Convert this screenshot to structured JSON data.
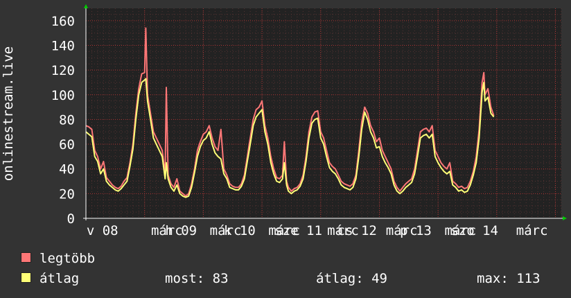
{
  "chart_data": {
    "type": "line",
    "ylabel": "onlinestream.live",
    "ylim": [
      0,
      170
    ],
    "yticks": [
      0,
      20,
      40,
      60,
      80,
      100,
      120,
      140,
      160
    ],
    "xlim": [
      0,
      8.1
    ],
    "xticks": [
      {
        "x": 0.28,
        "label": "v 08"
      },
      {
        "x": 1.38,
        "label": "márc"
      },
      {
        "x": 1.62,
        "label": "h 09"
      },
      {
        "x": 2.38,
        "label": "márc"
      },
      {
        "x": 2.62,
        "label": "k 10"
      },
      {
        "x": 3.38,
        "label": "márc"
      },
      {
        "x": 3.62,
        "label": "sze 11"
      },
      {
        "x": 4.38,
        "label": "márc"
      },
      {
        "x": 4.62,
        "label": "cs 12"
      },
      {
        "x": 5.38,
        "label": "márc"
      },
      {
        "x": 5.62,
        "label": "p 13"
      },
      {
        "x": 6.38,
        "label": "márc"
      },
      {
        "x": 6.62,
        "label": "szo 14"
      },
      {
        "x": 7.6,
        "label": "márc"
      }
    ],
    "grid": true,
    "colors": {
      "max": "#ff7777",
      "avg": "#ffff77",
      "grid": "#aa3333",
      "axis": "#ffffff",
      "background": "#222222"
    },
    "series": [
      {
        "name": "legtöbb",
        "color": "#ff7777",
        "points": [
          [
            0.0,
            75
          ],
          [
            0.05,
            74
          ],
          [
            0.1,
            72
          ],
          [
            0.15,
            55
          ],
          [
            0.2,
            50
          ],
          [
            0.25,
            40
          ],
          [
            0.3,
            46
          ],
          [
            0.35,
            33
          ],
          [
            0.4,
            30
          ],
          [
            0.45,
            27
          ],
          [
            0.5,
            25
          ],
          [
            0.55,
            24
          ],
          [
            0.6,
            26
          ],
          [
            0.65,
            30
          ],
          [
            0.7,
            33
          ],
          [
            0.75,
            45
          ],
          [
            0.8,
            60
          ],
          [
            0.85,
            85
          ],
          [
            0.9,
            105
          ],
          [
            0.95,
            117
          ],
          [
            1.0,
            118
          ],
          [
            1.02,
            154
          ],
          [
            1.05,
            100
          ],
          [
            1.1,
            85
          ],
          [
            1.15,
            70
          ],
          [
            1.2,
            65
          ],
          [
            1.25,
            60
          ],
          [
            1.3,
            55
          ],
          [
            1.35,
            35
          ],
          [
            1.37,
            106
          ],
          [
            1.4,
            35
          ],
          [
            1.45,
            28
          ],
          [
            1.5,
            25
          ],
          [
            1.55,
            32
          ],
          [
            1.6,
            22
          ],
          [
            1.65,
            20
          ],
          [
            1.7,
            18
          ],
          [
            1.75,
            20
          ],
          [
            1.8,
            28
          ],
          [
            1.85,
            40
          ],
          [
            1.9,
            55
          ],
          [
            1.95,
            62
          ],
          [
            2.0,
            68
          ],
          [
            2.05,
            70
          ],
          [
            2.1,
            75
          ],
          [
            2.15,
            65
          ],
          [
            2.2,
            58
          ],
          [
            2.25,
            55
          ],
          [
            2.3,
            72
          ],
          [
            2.35,
            40
          ],
          [
            2.4,
            35
          ],
          [
            2.45,
            28
          ],
          [
            2.5,
            26
          ],
          [
            2.55,
            25
          ],
          [
            2.6,
            25
          ],
          [
            2.65,
            28
          ],
          [
            2.7,
            35
          ],
          [
            2.75,
            50
          ],
          [
            2.8,
            65
          ],
          [
            2.85,
            80
          ],
          [
            2.9,
            88
          ],
          [
            2.95,
            90
          ],
          [
            3.0,
            95
          ],
          [
            3.05,
            75
          ],
          [
            3.1,
            65
          ],
          [
            3.15,
            50
          ],
          [
            3.2,
            40
          ],
          [
            3.25,
            33
          ],
          [
            3.3,
            32
          ],
          [
            3.35,
            35
          ],
          [
            3.38,
            62
          ],
          [
            3.42,
            30
          ],
          [
            3.45,
            25
          ],
          [
            3.5,
            22
          ],
          [
            3.55,
            24
          ],
          [
            3.6,
            25
          ],
          [
            3.65,
            28
          ],
          [
            3.7,
            35
          ],
          [
            3.75,
            50
          ],
          [
            3.8,
            70
          ],
          [
            3.85,
            82
          ],
          [
            3.9,
            86
          ],
          [
            3.95,
            87
          ],
          [
            4.0,
            70
          ],
          [
            4.05,
            65
          ],
          [
            4.1,
            55
          ],
          [
            4.15,
            45
          ],
          [
            4.2,
            42
          ],
          [
            4.25,
            40
          ],
          [
            4.3,
            35
          ],
          [
            4.35,
            30
          ],
          [
            4.4,
            28
          ],
          [
            4.45,
            27
          ],
          [
            4.5,
            26
          ],
          [
            4.55,
            28
          ],
          [
            4.6,
            35
          ],
          [
            4.65,
            55
          ],
          [
            4.7,
            78
          ],
          [
            4.75,
            90
          ],
          [
            4.8,
            85
          ],
          [
            4.85,
            75
          ],
          [
            4.9,
            70
          ],
          [
            4.95,
            62
          ],
          [
            5.0,
            65
          ],
          [
            5.05,
            55
          ],
          [
            5.1,
            50
          ],
          [
            5.15,
            45
          ],
          [
            5.2,
            40
          ],
          [
            5.25,
            30
          ],
          [
            5.3,
            25
          ],
          [
            5.35,
            22
          ],
          [
            5.4,
            25
          ],
          [
            5.45,
            28
          ],
          [
            5.5,
            30
          ],
          [
            5.55,
            32
          ],
          [
            5.6,
            40
          ],
          [
            5.65,
            55
          ],
          [
            5.7,
            70
          ],
          [
            5.75,
            72
          ],
          [
            5.8,
            73
          ],
          [
            5.85,
            70
          ],
          [
            5.9,
            75
          ],
          [
            5.95,
            55
          ],
          [
            6.0,
            50
          ],
          [
            6.05,
            45
          ],
          [
            6.1,
            42
          ],
          [
            6.15,
            40
          ],
          [
            6.2,
            45
          ],
          [
            6.25,
            30
          ],
          [
            6.3,
            28
          ],
          [
            6.35,
            25
          ],
          [
            6.4,
            26
          ],
          [
            6.45,
            24
          ],
          [
            6.5,
            25
          ],
          [
            6.55,
            30
          ],
          [
            6.6,
            38
          ],
          [
            6.65,
            50
          ],
          [
            6.7,
            72
          ],
          [
            6.75,
            110
          ],
          [
            6.78,
            118
          ],
          [
            6.8,
            100
          ],
          [
            6.85,
            105
          ],
          [
            6.9,
            90
          ],
          [
            6.95,
            83
          ]
        ]
      },
      {
        "name": "átlag",
        "color": "#ffff77",
        "points": [
          [
            0.0,
            70
          ],
          [
            0.05,
            68
          ],
          [
            0.1,
            66
          ],
          [
            0.15,
            50
          ],
          [
            0.2,
            46
          ],
          [
            0.25,
            36
          ],
          [
            0.3,
            40
          ],
          [
            0.35,
            30
          ],
          [
            0.4,
            27
          ],
          [
            0.45,
            25
          ],
          [
            0.5,
            23
          ],
          [
            0.55,
            22
          ],
          [
            0.6,
            24
          ],
          [
            0.65,
            27
          ],
          [
            0.7,
            30
          ],
          [
            0.75,
            42
          ],
          [
            0.8,
            56
          ],
          [
            0.85,
            80
          ],
          [
            0.9,
            100
          ],
          [
            0.95,
            110
          ],
          [
            1.0,
            112
          ],
          [
            1.02,
            113
          ],
          [
            1.05,
            95
          ],
          [
            1.1,
            80
          ],
          [
            1.15,
            65
          ],
          [
            1.2,
            60
          ],
          [
            1.25,
            55
          ],
          [
            1.3,
            50
          ],
          [
            1.35,
            32
          ],
          [
            1.37,
            45
          ],
          [
            1.4,
            32
          ],
          [
            1.45,
            25
          ],
          [
            1.5,
            22
          ],
          [
            1.55,
            27
          ],
          [
            1.6,
            20
          ],
          [
            1.65,
            18
          ],
          [
            1.7,
            17
          ],
          [
            1.75,
            18
          ],
          [
            1.8,
            25
          ],
          [
            1.85,
            37
          ],
          [
            1.9,
            50
          ],
          [
            1.95,
            58
          ],
          [
            2.0,
            63
          ],
          [
            2.05,
            65
          ],
          [
            2.1,
            70
          ],
          [
            2.15,
            60
          ],
          [
            2.2,
            53
          ],
          [
            2.25,
            50
          ],
          [
            2.3,
            48
          ],
          [
            2.35,
            36
          ],
          [
            2.4,
            32
          ],
          [
            2.45,
            25
          ],
          [
            2.5,
            24
          ],
          [
            2.55,
            23
          ],
          [
            2.6,
            23
          ],
          [
            2.65,
            26
          ],
          [
            2.7,
            32
          ],
          [
            2.75,
            46
          ],
          [
            2.8,
            60
          ],
          [
            2.85,
            75
          ],
          [
            2.9,
            82
          ],
          [
            2.95,
            85
          ],
          [
            3.0,
            88
          ],
          [
            3.05,
            70
          ],
          [
            3.1,
            60
          ],
          [
            3.15,
            45
          ],
          [
            3.2,
            36
          ],
          [
            3.25,
            30
          ],
          [
            3.3,
            29
          ],
          [
            3.35,
            32
          ],
          [
            3.38,
            45
          ],
          [
            3.42,
            27
          ],
          [
            3.45,
            22
          ],
          [
            3.5,
            20
          ],
          [
            3.55,
            22
          ],
          [
            3.6,
            23
          ],
          [
            3.65,
            26
          ],
          [
            3.7,
            32
          ],
          [
            3.75,
            46
          ],
          [
            3.8,
            65
          ],
          [
            3.85,
            77
          ],
          [
            3.9,
            80
          ],
          [
            3.95,
            81
          ],
          [
            4.0,
            65
          ],
          [
            4.05,
            60
          ],
          [
            4.1,
            50
          ],
          [
            4.15,
            41
          ],
          [
            4.2,
            38
          ],
          [
            4.25,
            36
          ],
          [
            4.3,
            32
          ],
          [
            4.35,
            27
          ],
          [
            4.4,
            25
          ],
          [
            4.45,
            24
          ],
          [
            4.5,
            23
          ],
          [
            4.55,
            25
          ],
          [
            4.6,
            32
          ],
          [
            4.65,
            50
          ],
          [
            4.7,
            72
          ],
          [
            4.75,
            86
          ],
          [
            4.8,
            80
          ],
          [
            4.85,
            70
          ],
          [
            4.9,
            65
          ],
          [
            4.95,
            57
          ],
          [
            5.0,
            58
          ],
          [
            5.05,
            50
          ],
          [
            5.1,
            45
          ],
          [
            5.15,
            41
          ],
          [
            5.2,
            36
          ],
          [
            5.25,
            27
          ],
          [
            5.3,
            22
          ],
          [
            5.35,
            20
          ],
          [
            5.4,
            22
          ],
          [
            5.45,
            25
          ],
          [
            5.5,
            27
          ],
          [
            5.55,
            29
          ],
          [
            5.6,
            36
          ],
          [
            5.65,
            50
          ],
          [
            5.7,
            65
          ],
          [
            5.75,
            67
          ],
          [
            5.8,
            68
          ],
          [
            5.85,
            65
          ],
          [
            5.9,
            68
          ],
          [
            5.95,
            50
          ],
          [
            6.0,
            45
          ],
          [
            6.05,
            41
          ],
          [
            6.1,
            38
          ],
          [
            6.15,
            36
          ],
          [
            6.2,
            38
          ],
          [
            6.25,
            27
          ],
          [
            6.3,
            25
          ],
          [
            6.35,
            22
          ],
          [
            6.4,
            23
          ],
          [
            6.45,
            21
          ],
          [
            6.5,
            22
          ],
          [
            6.55,
            27
          ],
          [
            6.6,
            35
          ],
          [
            6.65,
            45
          ],
          [
            6.7,
            65
          ],
          [
            6.75,
            102
          ],
          [
            6.78,
            110
          ],
          [
            6.8,
            95
          ],
          [
            6.85,
            98
          ],
          [
            6.9,
            85
          ],
          [
            6.95,
            82
          ]
        ]
      }
    ]
  },
  "legend": {
    "max_label": "legtöbb",
    "avg_label": "átlag"
  },
  "stats": {
    "now": "most: 83",
    "avg": "átlag: 49",
    "max": "max: 113"
  }
}
